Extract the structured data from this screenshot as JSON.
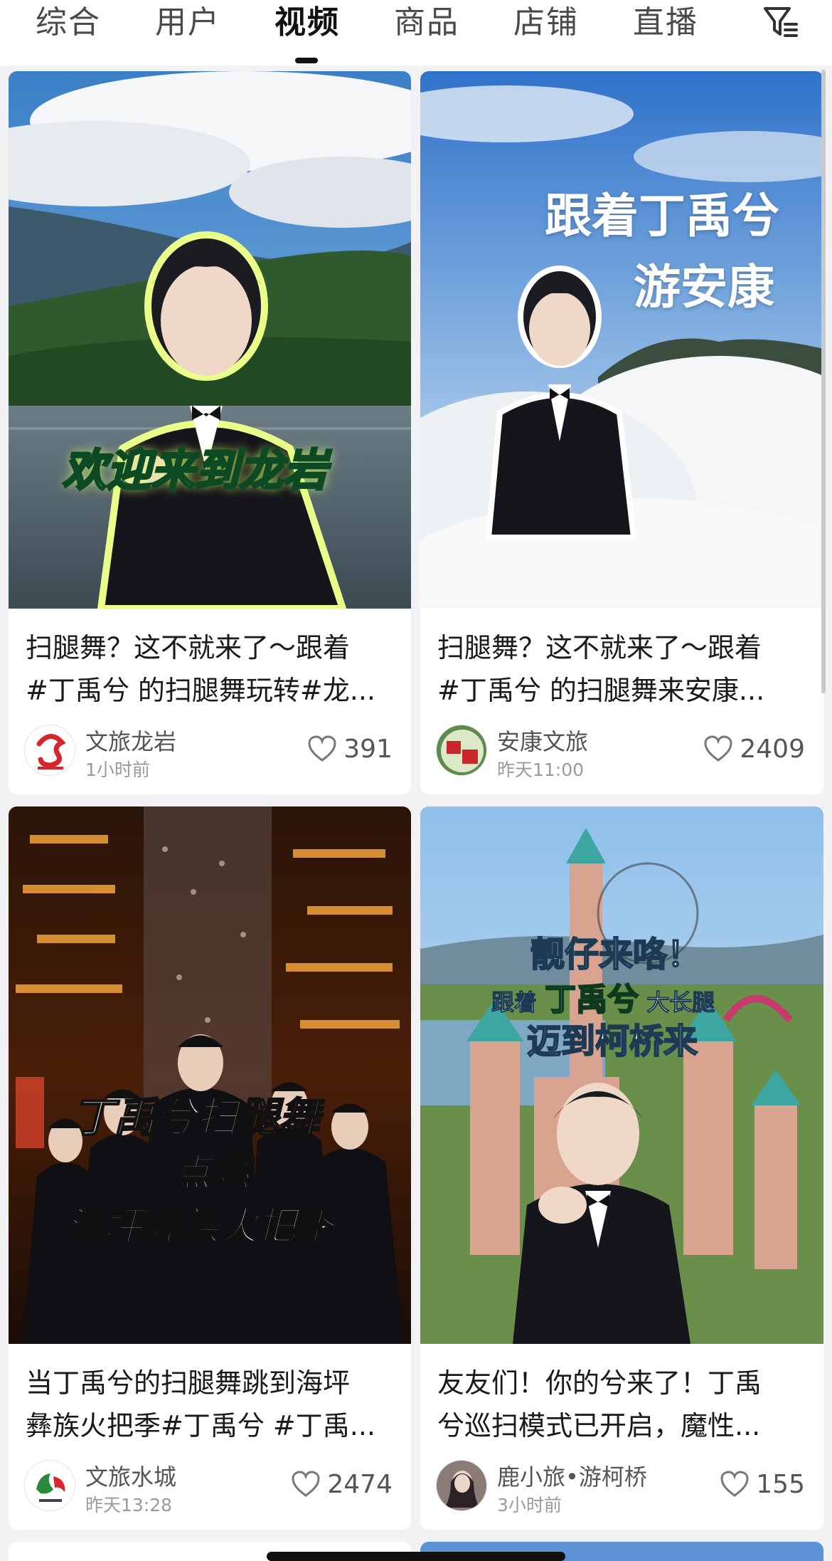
{
  "tabs": [
    {
      "label": "综合",
      "active": false
    },
    {
      "label": "用户",
      "active": false
    },
    {
      "label": "视频",
      "active": true
    },
    {
      "label": "商品",
      "active": false
    },
    {
      "label": "店铺",
      "active": false
    },
    {
      "label": "直播",
      "active": false
    }
  ],
  "filter_icon": "filter-icon",
  "colors": {
    "accent": "#111111",
    "card_bg": "#ffffff",
    "page_bg": "#f2f2f4",
    "overlay_green": "#2fd36b",
    "overlay_yellow_green": "#c7f24a"
  },
  "videos": [
    {
      "title_line1": "扫腿舞？这不就来了～跟着",
      "title_line2": "#丁禹兮 的扫腿舞玩转#龙...",
      "author": "文旅龙岩",
      "time": "1小时前",
      "likes": "391",
      "overlay": [
        "欢迎来到龙岩"
      ]
    },
    {
      "title_line1": "扫腿舞？这不就来了～跟着",
      "title_line2": "#丁禹兮 的扫腿舞来安康...",
      "author": "安康文旅",
      "time": "昨天11:00",
      "likes": "2409",
      "overlay": [
        "跟着丁禹兮",
        "游安康"
      ]
    },
    {
      "title_line1": "当丁禹兮的扫腿舞跳到海坪",
      "title_line2": "彝族火把季#丁禹兮 #丁禹...",
      "author": "文旅水城",
      "time": "昨天13:28",
      "likes": "2474",
      "overlay": [
        "丁禹兮扫腿舞",
        "点燃",
        "海坪彝族火把季"
      ]
    },
    {
      "title_line1": "友友们！你的兮来了！丁禹",
      "title_line2": "兮巡扫模式已开启，魔性...",
      "author": "鹿小旅•游柯桥",
      "time": "3小时前",
      "likes": "155",
      "overlay": [
        "靓仔来咯！",
        "跟着",
        "丁禹兮",
        "大长腿",
        "迈到柯桥来"
      ]
    }
  ]
}
